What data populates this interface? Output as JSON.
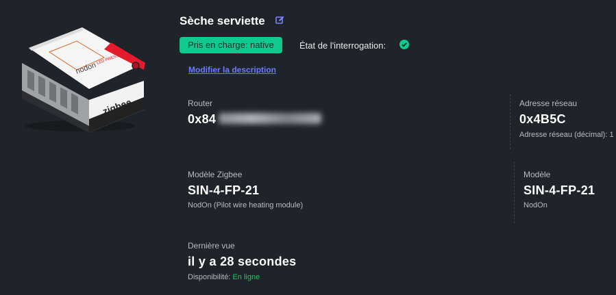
{
  "device": {
    "title": "Sèche serviette",
    "badge": "Pris en charge: native",
    "poll_label": "État de l'interrogation:",
    "edit_description_link": "Modifier la description",
    "image_labels": {
      "brand": "zigbee",
      "maker": "nodon",
      "led": "LED",
      "press": "PRESS"
    }
  },
  "fields": {
    "router": {
      "label": "Router",
      "value": "0x84"
    },
    "network_address": {
      "label": "Adresse réseau",
      "value": "0x4B5C",
      "sub": "Adresse réseau (décimal): 1"
    },
    "zigbee_model": {
      "label": "Modèle Zigbee",
      "value": "SIN-4-FP-21",
      "sub": "NodOn (Pilot wire heating module)"
    },
    "model": {
      "label": "Modèle",
      "value": "SIN-4-FP-21",
      "sub": "NodOn"
    },
    "last_seen": {
      "label": "Dernière vue",
      "value": "il y a 28 secondes",
      "availability_label": "Disponibilité:",
      "availability_value": "En ligne"
    }
  },
  "colors": {
    "background": "#1f232a",
    "badge": "#10c98f",
    "link": "#6b7cff",
    "online": "#22c55e"
  },
  "icons": [
    "edit-icon",
    "check-circle-icon"
  ]
}
